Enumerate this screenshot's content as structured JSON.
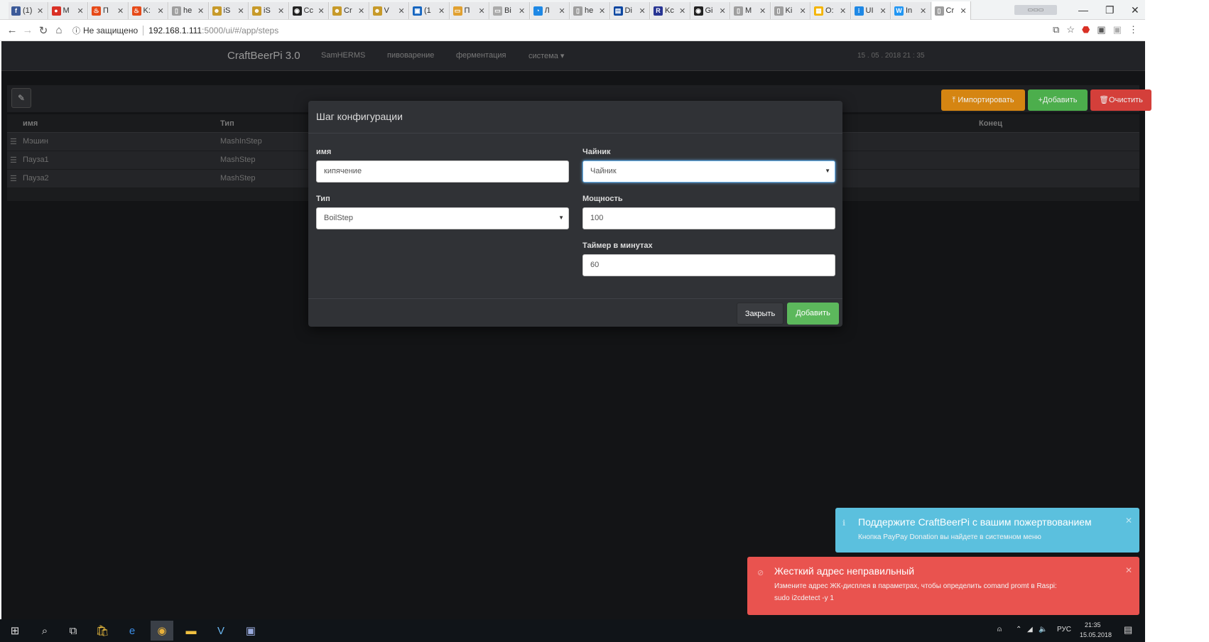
{
  "browser": {
    "tabs": [
      {
        "label": "(1)",
        "color": "#3b5998",
        "glyph": "f"
      },
      {
        "label": "M",
        "color": "#d93025",
        "glyph": "●"
      },
      {
        "label": "П",
        "color": "#e64a19",
        "glyph": "♨"
      },
      {
        "label": "K:",
        "color": "#e64a19",
        "glyph": "♨"
      },
      {
        "label": "he",
        "color": "#9e9e9e",
        "glyph": "▯"
      },
      {
        "label": "iS",
        "color": "#c79a2a",
        "glyph": "☻"
      },
      {
        "label": "iS",
        "color": "#c79a2a",
        "glyph": "☻"
      },
      {
        "label": "Cc",
        "color": "#222222",
        "glyph": "◉"
      },
      {
        "label": "Cr",
        "color": "#c79a2a",
        "glyph": "☻"
      },
      {
        "label": "V",
        "color": "#c79a2a",
        "glyph": "☻"
      },
      {
        "label": "(1",
        "color": "#1565c0",
        "glyph": "▣"
      },
      {
        "label": "П",
        "color": "#e0a030",
        "glyph": "▭"
      },
      {
        "label": "Bi",
        "color": "#aaaaaa",
        "glyph": "▭"
      },
      {
        "label": "Л",
        "color": "#1e88e5",
        "glyph": "◔"
      },
      {
        "label": "he",
        "color": "#9e9e9e",
        "glyph": "▯"
      },
      {
        "label": "Di",
        "color": "#0d47a1",
        "glyph": "▤"
      },
      {
        "label": "Kc",
        "color": "#283593",
        "glyph": "R"
      },
      {
        "label": "Gi",
        "color": "#222222",
        "glyph": "◉"
      },
      {
        "label": "M",
        "color": "#9e9e9e",
        "glyph": "▯"
      },
      {
        "label": "Ki",
        "color": "#9e9e9e",
        "glyph": "▯"
      },
      {
        "label": "O:",
        "color": "#f4b400",
        "glyph": "▦"
      },
      {
        "label": "UI",
        "color": "#1e88e5",
        "glyph": "⁝"
      },
      {
        "label": "In",
        "color": "#2196f3",
        "glyph": "W"
      },
      {
        "label": "Cr",
        "color": "#9e9e9e",
        "glyph": "▯"
      }
    ],
    "security_label": "Не защищено",
    "url_host": "192.168.1.111",
    "url_path": ":5000/ui/#/app/steps"
  },
  "app": {
    "brand": "CraftBeerPi 3.0",
    "nav": [
      "SamHERMS",
      "пивоварение",
      "ферментация",
      "система ▾"
    ],
    "clock": "15 . 05 . 2018 21 : 35",
    "actions": {
      "import": "Импортировать",
      "add": "Добавить",
      "clear": "Очистить"
    },
    "table": {
      "headers": {
        "name": "имя",
        "type": "Тип",
        "end": "Конец"
      },
      "rows": [
        {
          "name": "Мэшин",
          "type": "MashInStep"
        },
        {
          "name": "Пауза1",
          "type": "MashStep"
        },
        {
          "name": "Пауза2",
          "type": "MashStep"
        }
      ]
    }
  },
  "modal": {
    "title": "Шаг конфигурации",
    "name_label": "имя",
    "name_value": "кипячение",
    "kettle_label": "Чайник",
    "kettle_value": "Чайник",
    "type_label": "Тип",
    "type_value": "BoilStep",
    "power_label": "Мощность",
    "power_value": "100",
    "timer_label": "Таймер в минутах",
    "timer_value": "60",
    "close_label": "Закрыть",
    "add_label": "Добавить"
  },
  "toasts": {
    "info_title": "Поддержите CraftBeerPi с вашим пожертвованием",
    "info_msg": "Кнопка PayPay Donation вы найдете в системном меню",
    "error_title": "Жесткий адрес неправильный",
    "error_msg1": "Измените адрес ЖК-дисплея в параметрах, чтобы определить comand promt в Raspi:",
    "error_msg2": "sudo i2cdetect -y 1"
  },
  "taskbar": {
    "lang": "РУС",
    "time": "21:35",
    "date": "15.05.2018"
  },
  "colors": {
    "import": "#d58512",
    "add": "#4cae4c",
    "clear": "#d43f3a",
    "info": "#5bc0de",
    "error": "#e9534f"
  }
}
